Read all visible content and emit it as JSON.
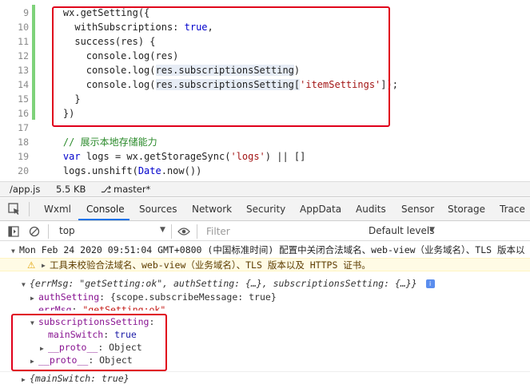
{
  "editor": {
    "lines": [
      {
        "n": "9",
        "segments": [
          {
            "t": "    wx.getSetting({",
            "c": "plain"
          }
        ]
      },
      {
        "n": "10",
        "segments": [
          {
            "t": "      withSubscriptions: ",
            "c": "plain"
          },
          {
            "t": "true",
            "c": "kw"
          },
          {
            "t": ",",
            "c": "plain"
          }
        ]
      },
      {
        "n": "11",
        "segments": [
          {
            "t": "      success(res) {",
            "c": "plain"
          }
        ]
      },
      {
        "n": "12",
        "segments": [
          {
            "t": "        console.log(res)",
            "c": "plain"
          }
        ]
      },
      {
        "n": "13",
        "segments": [
          {
            "t": "        console.log(",
            "c": "plain"
          },
          {
            "t": "res.subscriptionsSetting",
            "c": "plain hl"
          },
          {
            "t": ")",
            "c": "plain"
          }
        ]
      },
      {
        "n": "14",
        "segments": [
          {
            "t": "        console.log(",
            "c": "plain"
          },
          {
            "t": "res.subscriptionsSetting[",
            "c": "plain hl"
          },
          {
            "t": "'itemSettings'",
            "c": "str"
          },
          {
            "t": "]);",
            "c": "plain"
          }
        ]
      },
      {
        "n": "15",
        "segments": [
          {
            "t": "      }",
            "c": "plain"
          }
        ]
      },
      {
        "n": "16",
        "segments": [
          {
            "t": "    })",
            "c": "plain"
          }
        ]
      },
      {
        "n": "17",
        "segments": [
          {
            "t": "",
            "c": "plain"
          }
        ]
      },
      {
        "n": "18",
        "segments": [
          {
            "t": "    // 展示本地存储能力",
            "c": "cm"
          }
        ]
      },
      {
        "n": "19",
        "segments": [
          {
            "t": "    ",
            "c": "plain"
          },
          {
            "t": "var",
            "c": "kw"
          },
          {
            "t": " logs = wx.getStorageSync(",
            "c": "plain"
          },
          {
            "t": "'logs'",
            "c": "str"
          },
          {
            "t": ") || []",
            "c": "plain"
          }
        ]
      },
      {
        "n": "20",
        "segments": [
          {
            "t": "    logs.unshift(",
            "c": "plain"
          },
          {
            "t": "Date",
            "c": "kw"
          },
          {
            "t": ".now())",
            "c": "plain"
          }
        ]
      }
    ]
  },
  "statusbar": {
    "file": "/app.js",
    "size": "5.5 KB",
    "branch": "master*"
  },
  "tabs": [
    "Wxml",
    "Console",
    "Sources",
    "Network",
    "Security",
    "AppData",
    "Audits",
    "Sensor",
    "Storage",
    "Trace"
  ],
  "toolbar": {
    "context": "top",
    "filter_placeholder": "Filter",
    "levels": "Default levels"
  },
  "console": {
    "header": "Mon Feb 24 2020 09:51:04 GMT+0800 (中国标准时间) 配置中关闭合法域名、web-view（业务域名）、TLS 版本以",
    "warning": "工具未校验合法域名、web-view（业务域名）、TLS 版本以及 HTTPS 证书。",
    "obj_summary": "{errMsg: \"getSetting:ok\", authSetting: {…}, subscriptionsSetting: {…}}",
    "auth_key": "authSetting",
    "auth_val": "{scope.subscribeMessage: true}",
    "errmsg_key": "errMsg",
    "errmsg_val": "\"getSetting:ok\"",
    "sub_key": "subscriptionsSetting",
    "main_key": "mainSwitch",
    "main_val": "true",
    "proto_key": "__proto__",
    "proto_val": "Object",
    "last": "{mainSwitch: true}"
  }
}
